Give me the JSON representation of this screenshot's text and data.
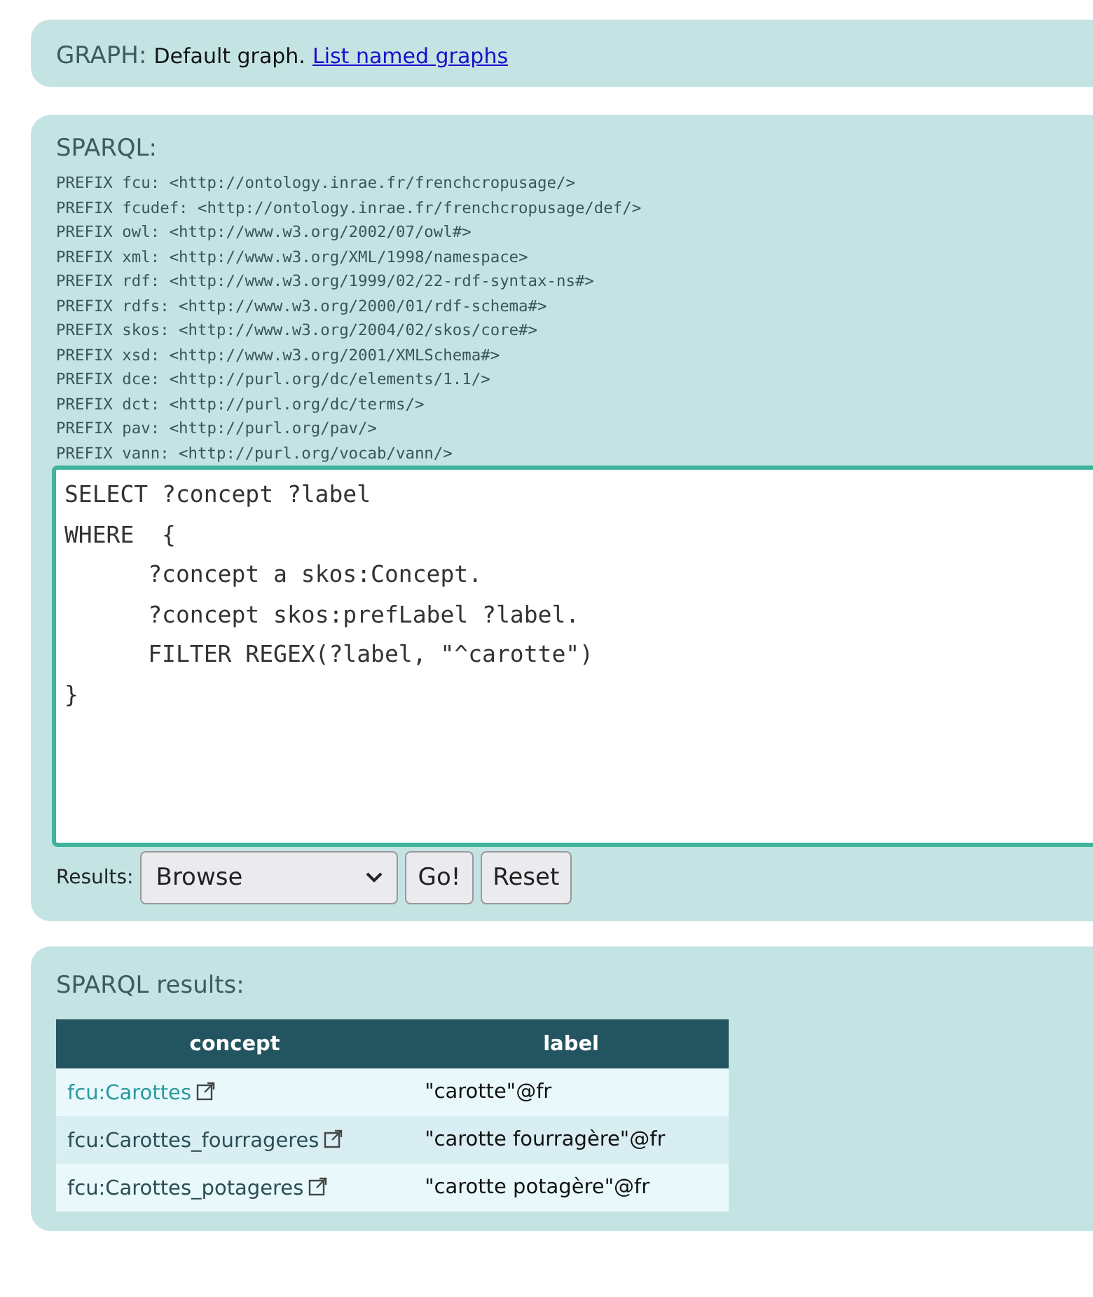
{
  "graph": {
    "label": "GRAPH:",
    "text": "Default graph.",
    "link": "List named graphs"
  },
  "sparql": {
    "label": "SPARQL:",
    "prefixes": [
      "PREFIX fcu: <http://ontology.inrae.fr/frenchcropusage/>",
      "PREFIX fcudef: <http://ontology.inrae.fr/frenchcropusage/def/>",
      "PREFIX owl: <http://www.w3.org/2002/07/owl#>",
      "PREFIX xml: <http://www.w3.org/XML/1998/namespace>",
      "PREFIX rdf: <http://www.w3.org/1999/02/22-rdf-syntax-ns#>",
      "PREFIX rdfs: <http://www.w3.org/2000/01/rdf-schema#>",
      "PREFIX skos: <http://www.w3.org/2004/02/skos/core#>",
      "PREFIX xsd: <http://www.w3.org/2001/XMLSchema#>",
      "PREFIX dce: <http://purl.org/dc/elements/1.1/>",
      "PREFIX dct: <http://purl.org/dc/terms/>",
      "PREFIX pav: <http://purl.org/pav/>",
      "PREFIX vann: <http://purl.org/vocab/vann/>"
    ],
    "query": "SELECT ?concept ?label\nWHERE  {\n      ?concept a skos:Concept.\n      ?concept skos:prefLabel ?label.\n      FILTER REGEX(?label, \"^carotte\")\n}",
    "results_label": "Results:",
    "results_value": "Browse",
    "buttons": [
      "Go!",
      "Reset"
    ]
  },
  "results": {
    "title": "SPARQL results:",
    "columns": [
      "concept",
      "label"
    ],
    "rows": [
      {
        "concept": "fcu:Carottes",
        "visited": true,
        "label": "\"carotte\"@fr"
      },
      {
        "concept": "fcu:Carottes_fourrageres",
        "visited": false,
        "label": "\"carotte fourragère\"@fr"
      },
      {
        "concept": "fcu:Carottes_potageres",
        "visited": false,
        "label": "\"carotte potagère\"@fr"
      }
    ]
  }
}
